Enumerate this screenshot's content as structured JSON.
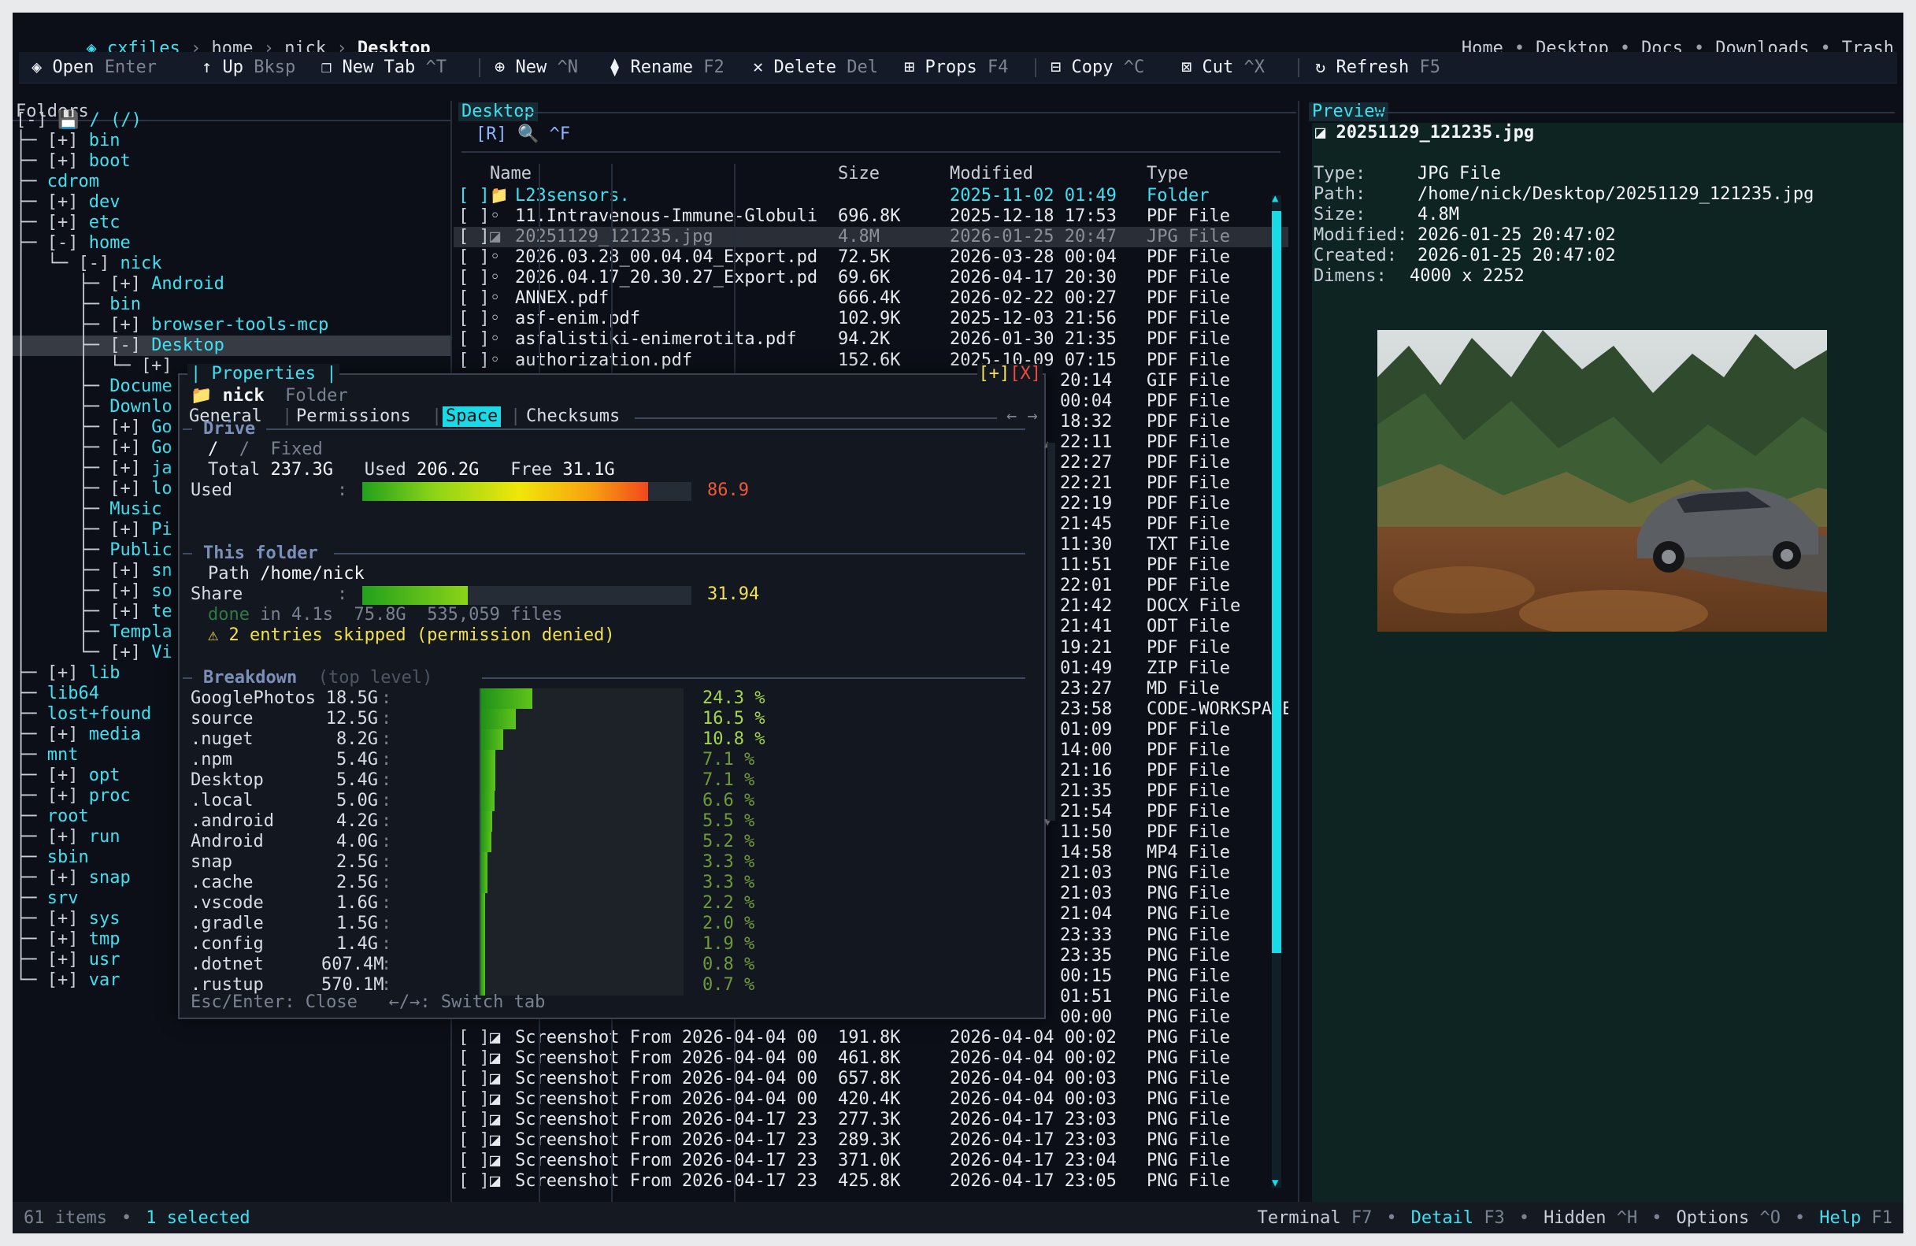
{
  "breadcrumb": {
    "app": "cxfiles",
    "parts": [
      "home",
      "nick"
    ],
    "current": "Desktop"
  },
  "quicklinks": [
    "Home",
    "Desktop",
    "Docs",
    "Downloads",
    "Trash"
  ],
  "toolbar": [
    {
      "icon": "◈",
      "label": "Open",
      "key": "Enter"
    },
    {
      "icon": "↑",
      "label": "Up",
      "key": "Bksp"
    },
    {
      "icon": "❐",
      "label": "New Tab",
      "key": "^T"
    },
    {
      "icon": "⊕",
      "label": "New",
      "key": "^N"
    },
    {
      "icon": "⧫",
      "label": "Rename",
      "key": "F2"
    },
    {
      "icon": "✕",
      "label": "Delete",
      "key": "Del"
    },
    {
      "icon": "⊞",
      "label": "Props",
      "key": "F4"
    },
    {
      "icon": "⊟",
      "label": "Copy",
      "key": "^C"
    },
    {
      "icon": "⊠",
      "label": "Cut",
      "key": "^X"
    },
    {
      "icon": "↻",
      "label": "Refresh",
      "key": "F5"
    }
  ],
  "folders": {
    "title": "Folders",
    "items": [
      {
        "prefix": "[-] 💾 ",
        "name": "/ (/)"
      },
      {
        "prefix": "├─ [+] ",
        "name": "bin"
      },
      {
        "prefix": "├─ [+] ",
        "name": "boot"
      },
      {
        "prefix": "├─ ",
        "name": "cdrom"
      },
      {
        "prefix": "├─ [+] ",
        "name": "dev"
      },
      {
        "prefix": "├─ [+] ",
        "name": "etc"
      },
      {
        "prefix": "├─ [-] ",
        "name": "home"
      },
      {
        "prefix": "│  └─ [-] ",
        "name": "nick"
      },
      {
        "prefix": "│     ├─ [+] ",
        "name": "Android"
      },
      {
        "prefix": "│     ├─ ",
        "name": "bin"
      },
      {
        "prefix": "│     ├─ [+] ",
        "name": "browser-tools-mcp"
      },
      {
        "prefix": "│     ├─ [-] ",
        "name": "Desktop"
      },
      {
        "prefix": "│     │  └─ [+] ",
        "name": ""
      },
      {
        "prefix": "│     ├─ ",
        "name": "Docume"
      },
      {
        "prefix": "│     ├─ ",
        "name": "Downlo"
      },
      {
        "prefix": "│     ├─ [+] ",
        "name": "Go"
      },
      {
        "prefix": "│     ├─ [+] ",
        "name": "Go"
      },
      {
        "prefix": "│     ├─ [+] ",
        "name": "ja"
      },
      {
        "prefix": "│     ├─ [+] ",
        "name": "lo"
      },
      {
        "prefix": "│     ├─ ",
        "name": "Music"
      },
      {
        "prefix": "│     ├─ [+] ",
        "name": "Pi"
      },
      {
        "prefix": "│     ├─ ",
        "name": "Public"
      },
      {
        "prefix": "│     ├─ [+] ",
        "name": "sn"
      },
      {
        "prefix": "│     ├─ [+] ",
        "name": "so"
      },
      {
        "prefix": "│     ├─ [+] ",
        "name": "te"
      },
      {
        "prefix": "│     ├─ ",
        "name": "Templa"
      },
      {
        "prefix": "│     └─ [+] ",
        "name": "Vi"
      },
      {
        "prefix": "├─ [+] ",
        "name": "lib"
      },
      {
        "prefix": "├─ ",
        "name": "lib64"
      },
      {
        "prefix": "├─ ",
        "name": "lost+found"
      },
      {
        "prefix": "├─ [+] ",
        "name": "media"
      },
      {
        "prefix": "├─ ",
        "name": "mnt"
      },
      {
        "prefix": "├─ [+] ",
        "name": "opt"
      },
      {
        "prefix": "├─ [+] ",
        "name": "proc"
      },
      {
        "prefix": "├─ ",
        "name": "root"
      },
      {
        "prefix": "├─ [+] ",
        "name": "run"
      },
      {
        "prefix": "├─ ",
        "name": "sbin"
      },
      {
        "prefix": "├─ [+] ",
        "name": "snap"
      },
      {
        "prefix": "├─ ",
        "name": "srv"
      },
      {
        "prefix": "├─ [+] ",
        "name": "sys"
      },
      {
        "prefix": "├─ [+] ",
        "name": "tmp"
      },
      {
        "prefix": "├─ [+] ",
        "name": "usr"
      },
      {
        "prefix": "└─ [+] ",
        "name": "var"
      }
    ]
  },
  "files": {
    "title": "Desktop",
    "search_hint": "[R] 🔍 ^F",
    "columns": [
      "Name",
      "Size",
      "Modified",
      "Type"
    ],
    "rows": [
      {
        "icon": "📁",
        "name": "L23sensors.",
        "size": "",
        "modified": "2025-11-02 01:49",
        "type": "Folder"
      },
      {
        "icon": "◦",
        "name": "11.Intravenous-Immune-Globuli",
        "size": "696.8K",
        "modified": "2025-12-18 17:53",
        "type": "PDF File"
      },
      {
        "icon": "◪",
        "name": "20251129_121235.jpg",
        "size": "4.8M",
        "modified": "2026-01-25 20:47",
        "type": "JPG File"
      },
      {
        "icon": "◦",
        "name": "2026.03.28_00.04.04_Export.pd",
        "size": "72.5K",
        "modified": "2026-03-28 00:04",
        "type": "PDF File"
      },
      {
        "icon": "◦",
        "name": "2026.04.17_20.30.27_Export.pd",
        "size": "69.6K",
        "modified": "2026-04-17 20:30",
        "type": "PDF File"
      },
      {
        "icon": "◦",
        "name": "ANNEX.pdf",
        "size": "666.4K",
        "modified": "2026-02-22 00:27",
        "type": "PDF File"
      },
      {
        "icon": "◦",
        "name": "asf-enim.pdf",
        "size": "102.9K",
        "modified": "2025-12-03 21:56",
        "type": "PDF File"
      },
      {
        "icon": "◦",
        "name": "asfalistiki-enimerotita.pdf",
        "size": "94.2K",
        "modified": "2026-01-30 21:35",
        "type": "PDF File"
      },
      {
        "icon": "◦",
        "name": "authorization.pdf",
        "size": "152.6K",
        "modified": "2025-10-09 07:15",
        "type": "PDF File"
      },
      {
        "icon": "",
        "name": "",
        "size": "",
        "modified": "20:14",
        "type": "GIF File"
      },
      {
        "icon": "",
        "name": "",
        "size": "",
        "modified": "00:04",
        "type": "PDF File"
      },
      {
        "icon": "",
        "name": "",
        "size": "",
        "modified": "18:32",
        "type": "PDF File"
      },
      {
        "icon": "",
        "name": "",
        "size": "",
        "modified": "22:11",
        "type": "PDF File"
      },
      {
        "icon": "",
        "name": "",
        "size": "",
        "modified": "22:27",
        "type": "PDF File"
      },
      {
        "icon": "",
        "name": "",
        "size": "",
        "modified": "22:21",
        "type": "PDF File"
      },
      {
        "icon": "",
        "name": "",
        "size": "",
        "modified": "22:19",
        "type": "PDF File"
      },
      {
        "icon": "",
        "name": "",
        "size": "",
        "modified": "21:45",
        "type": "PDF File"
      },
      {
        "icon": "",
        "name": "",
        "size": "",
        "modified": "11:30",
        "type": "TXT File"
      },
      {
        "icon": "",
        "name": "",
        "size": "",
        "modified": "11:51",
        "type": "PDF File"
      },
      {
        "icon": "",
        "name": "",
        "size": "",
        "modified": "22:01",
        "type": "PDF File"
      },
      {
        "icon": "",
        "name": "",
        "size": "",
        "modified": "21:42",
        "type": "DOCX File"
      },
      {
        "icon": "",
        "name": "",
        "size": "",
        "modified": "21:41",
        "type": "ODT File"
      },
      {
        "icon": "",
        "name": "",
        "size": "",
        "modified": "19:21",
        "type": "PDF File"
      },
      {
        "icon": "",
        "name": "",
        "size": "",
        "modified": "01:49",
        "type": "ZIP File"
      },
      {
        "icon": "",
        "name": "",
        "size": "",
        "modified": "23:27",
        "type": "MD File"
      },
      {
        "icon": "",
        "name": "",
        "size": "",
        "modified": "23:58",
        "type": "CODE-WORKSPACE"
      },
      {
        "icon": "",
        "name": "",
        "size": "",
        "modified": "01:09",
        "type": "PDF File"
      },
      {
        "icon": "",
        "name": "",
        "size": "",
        "modified": "14:00",
        "type": "PDF File"
      },
      {
        "icon": "",
        "name": "",
        "size": "",
        "modified": "21:16",
        "type": "PDF File"
      },
      {
        "icon": "",
        "name": "",
        "size": "",
        "modified": "21:35",
        "type": "PDF File"
      },
      {
        "icon": "",
        "name": "",
        "size": "",
        "modified": "21:54",
        "type": "PDF File"
      },
      {
        "icon": "",
        "name": "",
        "size": "",
        "modified": "11:50",
        "type": "PDF File"
      },
      {
        "icon": "",
        "name": "",
        "size": "",
        "modified": "14:58",
        "type": "MP4 File"
      },
      {
        "icon": "",
        "name": "",
        "size": "",
        "modified": "21:03",
        "type": "PNG File"
      },
      {
        "icon": "",
        "name": "",
        "size": "",
        "modified": "21:03",
        "type": "PNG File"
      },
      {
        "icon": "",
        "name": "",
        "size": "",
        "modified": "21:04",
        "type": "PNG File"
      },
      {
        "icon": "",
        "name": "",
        "size": "",
        "modified": "23:33",
        "type": "PNG File"
      },
      {
        "icon": "",
        "name": "",
        "size": "",
        "modified": "23:35",
        "type": "PNG File"
      },
      {
        "icon": "",
        "name": "",
        "size": "",
        "modified": "00:15",
        "type": "PNG File"
      },
      {
        "icon": "",
        "name": "",
        "size": "",
        "modified": "01:51",
        "type": "PNG File"
      },
      {
        "icon": "",
        "name": "",
        "size": "",
        "modified": "00:00",
        "type": "PNG File"
      },
      {
        "icon": "◪",
        "name": "Screenshot From 2026-04-04 00",
        "size": "191.8K",
        "modified": "2026-04-04 00:02",
        "type": "PNG File"
      },
      {
        "icon": "◪",
        "name": "Screenshot From 2026-04-04 00",
        "size": "461.8K",
        "modified": "2026-04-04 00:02",
        "type": "PNG File"
      },
      {
        "icon": "◪",
        "name": "Screenshot From 2026-04-04 00",
        "size": "657.8K",
        "modified": "2026-04-04 00:03",
        "type": "PNG File"
      },
      {
        "icon": "◪",
        "name": "Screenshot From 2026-04-04 00",
        "size": "420.4K",
        "modified": "2026-04-04 00:03",
        "type": "PNG File"
      },
      {
        "icon": "◪",
        "name": "Screenshot From 2026-04-17 23",
        "size": "277.3K",
        "modified": "2026-04-17 23:03",
        "type": "PNG File"
      },
      {
        "icon": "◪",
        "name": "Screenshot From 2026-04-17 23",
        "size": "289.3K",
        "modified": "2026-04-17 23:03",
        "type": "PNG File"
      },
      {
        "icon": "◪",
        "name": "Screenshot From 2026-04-17 23",
        "size": "371.0K",
        "modified": "2026-04-17 23:04",
        "type": "PNG File"
      },
      {
        "icon": "◪",
        "name": "Screenshot From 2026-04-17 23",
        "size": "425.8K",
        "modified": "2026-04-17 23:05",
        "type": "PNG File"
      }
    ]
  },
  "preview": {
    "title": "Preview",
    "filename": "20251129_121235.jpg",
    "fields": [
      {
        "label": "Type:",
        "value": "JPG File"
      },
      {
        "label": "Path:",
        "value": "/home/nick/Desktop/20251129_121235.jpg"
      },
      {
        "label": "Size:",
        "value": "4.8M"
      },
      {
        "label": "Modified:",
        "value": "2026-01-25 20:47:02"
      },
      {
        "label": "Created:",
        "value": "2026-01-25 20:47:02"
      },
      {
        "label": "Dimens:",
        "value": "4000 x 2252"
      }
    ]
  },
  "status": {
    "items": "61 items",
    "selected": "1 selected",
    "right": [
      {
        "label": "Terminal",
        "key": "F7"
      },
      {
        "label": "Detail",
        "key": "F3"
      },
      {
        "label": "Hidden",
        "key": "^H"
      },
      {
        "label": "Options",
        "key": "^O"
      },
      {
        "label": "Help",
        "key": "F1"
      }
    ]
  },
  "modal": {
    "title": "Properties",
    "close": "[X]",
    "expand": "[+]",
    "folder_name": "nick",
    "folder_kind": "Folder",
    "tabs": [
      "General",
      "Permissions",
      "Space",
      "Checksums"
    ],
    "active_tab": "Space",
    "nav_arrows": "← →",
    "drive_heading": "Drive",
    "drive_mount": "/  /  Fixed",
    "total_label": "Total",
    "total": "237.3G",
    "used_label": "Used",
    "used": "206.2G",
    "free_label": "Free",
    "free": "31.1G",
    "used_bar_label": "Used",
    "used_pct": "86.9",
    "used_fraction": 0.869,
    "folder_heading": "This folder",
    "path_label": "Path",
    "path": "/home/nick",
    "share_label": "Share",
    "share_pct": "31.94",
    "share_fraction": 0.3194,
    "scan_status": "done",
    "scan_time": "in 4.1s",
    "scan_size": "75.8G",
    "scan_files": "535,059 files",
    "warning": "⚠ 2 entries skipped (permission denied)",
    "breakdown_heading": "Breakdown",
    "breakdown_sub": "(top level)",
    "breakdown": [
      {
        "name": "GooglePhotos",
        "size": "18.5G",
        "pct": 24.3
      },
      {
        "name": "source",
        "size": "12.5G",
        "pct": 16.5
      },
      {
        "name": ".nuget",
        "size": "8.2G",
        "pct": 10.8
      },
      {
        "name": ".npm",
        "size": "5.4G",
        "pct": 7.1
      },
      {
        "name": "Desktop",
        "size": "5.4G",
        "pct": 7.1
      },
      {
        "name": ".local",
        "size": "5.0G",
        "pct": 6.6
      },
      {
        "name": ".android",
        "size": "4.2G",
        "pct": 5.5
      },
      {
        "name": "Android",
        "size": "4.0G",
        "pct": 5.2
      },
      {
        "name": "snap",
        "size": "2.5G",
        "pct": 3.3
      },
      {
        "name": ".cache",
        "size": "2.5G",
        "pct": 3.3
      },
      {
        "name": ".vscode",
        "size": "1.6G",
        "pct": 2.2
      },
      {
        "name": ".gradle",
        "size": "1.5G",
        "pct": 2.0
      },
      {
        "name": ".config",
        "size": "1.4G",
        "pct": 1.9
      },
      {
        "name": ".dotnet",
        "size": "607.4M",
        "pct": 0.8
      },
      {
        "name": ".rustup",
        "size": "570.1M",
        "pct": 0.7
      }
    ],
    "footer": "Esc/Enter: Close   ←/→: Switch tab"
  }
}
